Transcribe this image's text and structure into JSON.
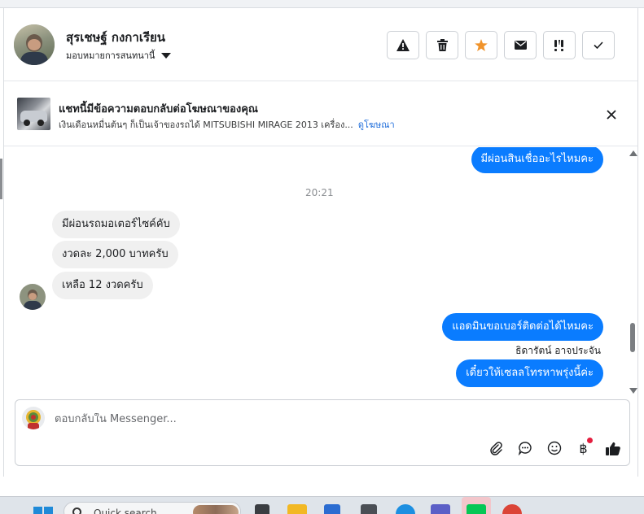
{
  "header": {
    "contact_name": "สุรเชษฐ์ กงกาเรียน",
    "assign_label": "มอบหมายการสนทนานี้",
    "actions": [
      {
        "name": "spam-button",
        "icon": "warning-icon"
      },
      {
        "name": "delete-button",
        "icon": "trash-icon"
      },
      {
        "name": "star-button",
        "icon": "star-icon"
      },
      {
        "name": "mark-unread-button",
        "icon": "envelope-icon"
      },
      {
        "name": "follow-up-button",
        "icon": "flag-exclamation-icon"
      },
      {
        "name": "mark-done-button",
        "icon": "checkmark-icon"
      }
    ]
  },
  "ad": {
    "title": "แชทนี้มีข้อความตอบกลับต่อโฆษณาของคุณ",
    "description": "เงินเดือนหมื่นต้นๆ ก็เป็นเจ้าของรถได้ MITSUBISHI MIRAGE 2013 เครื่อง...",
    "link": "ดูโฆษณา"
  },
  "conversation": {
    "messages_top": [
      {
        "text": "มีผ่อนสินเชื่ออะไรไหมคะ",
        "direction": "out"
      }
    ],
    "timestamp": "20:21",
    "incoming": [
      {
        "text": "มีผ่อนรถมอเตอร์ไซค์คับ"
      },
      {
        "text": "งวดละ 2,000 บาทครับ"
      },
      {
        "text": "เหลือ 12 งวดครับ"
      }
    ],
    "outgoing_1": "แอดมินขอเบอร์ติดต่อได้ไหมคะ",
    "sender_name": "ธิดารัตน์ อาจประจัน",
    "outgoing_2": "เดี๋ยวให้เซลลโทรหาพรุ่งนี้ค่ะ"
  },
  "composer": {
    "placeholder": "ตอบกลับใน Messenger..."
  },
  "taskbar": {
    "search_text": "Quick search"
  },
  "colors": {
    "outgoing_bubble": "#0a7cff",
    "incoming_bubble": "#f0f0f0",
    "star": "#f0932b",
    "link": "#216fdb"
  }
}
